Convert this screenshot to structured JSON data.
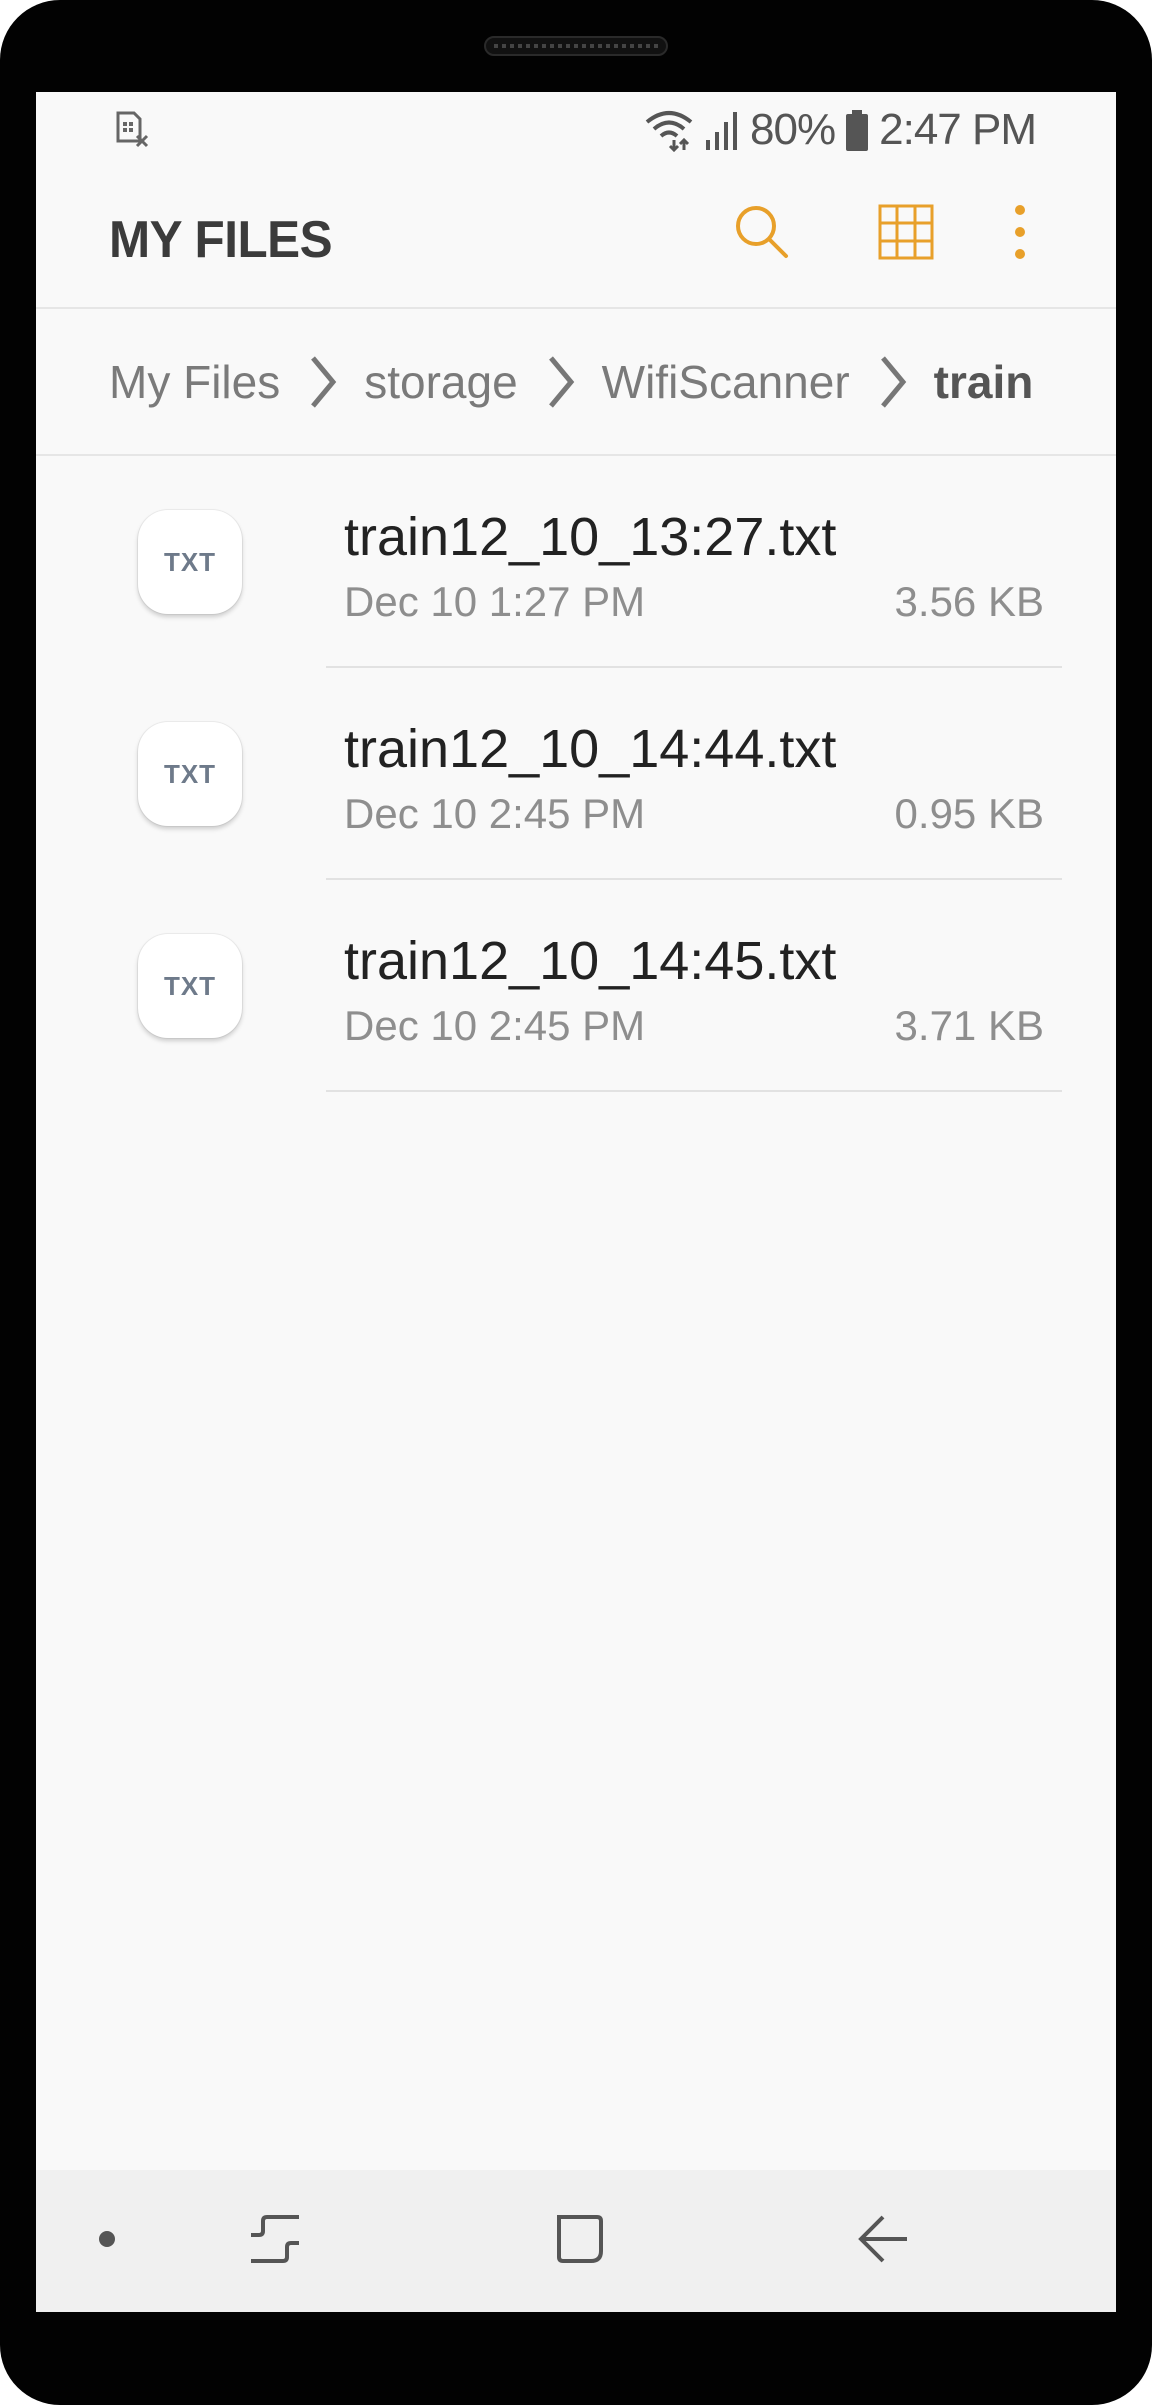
{
  "status_bar": {
    "battery": "80%",
    "time": "2:47 PM",
    "icons": [
      "sim-card-off-icon",
      "wifi-icon",
      "signal-icon",
      "battery-icon"
    ]
  },
  "app_bar": {
    "title": "MY FILES",
    "actions": [
      "search-icon",
      "grid-view-icon",
      "more-options-icon"
    ]
  },
  "breadcrumb": {
    "items": [
      "My Files",
      "storage",
      "WifiScanner",
      "train"
    ]
  },
  "files": [
    {
      "type": "TXT",
      "name": "train12_10_13:27.txt",
      "date": "Dec 10 1:27 PM",
      "size": "3.56 KB"
    },
    {
      "type": "TXT",
      "name": "train12_10_14:44.txt",
      "date": "Dec 10 2:45 PM",
      "size": "0.95 KB"
    },
    {
      "type": "TXT",
      "name": "train12_10_14:45.txt",
      "date": "Dec 10 2:45 PM",
      "size": "3.71 KB"
    }
  ],
  "nav_bar": {
    "buttons": [
      "dot-icon",
      "recents-icon",
      "home-icon",
      "back-icon"
    ]
  },
  "colors": {
    "accent": "#e8a02a",
    "background": "#f9f9f9",
    "title": "#3b3b3b",
    "secondary_text": "#8e8e8e"
  }
}
